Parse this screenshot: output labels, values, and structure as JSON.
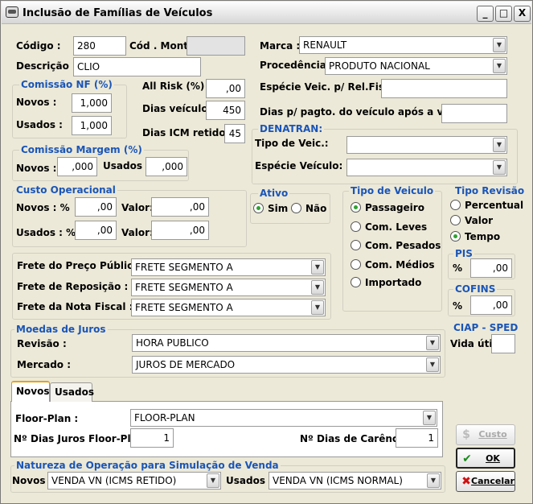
{
  "window": {
    "title": "Inclusão de Famílias de Veículos",
    "min": "_",
    "max": "□",
    "close": "X"
  },
  "codigo": {
    "label": "Código :",
    "value": "280"
  },
  "cod_mont": {
    "label": "Cód . Mont.:",
    "value": ""
  },
  "descricao": {
    "label": "Descrição :",
    "value": "CLIO"
  },
  "comissao_nf": {
    "title": "Comissão NF (%)",
    "novos_label": "Novos :",
    "novos": "1,000",
    "usados_label": "Usados :",
    "usados": "1,000"
  },
  "all_risk": {
    "label": "All Risk (%) :",
    "value": ",00"
  },
  "dias_veiculo": {
    "label": "Dias veículo:",
    "value": "450"
  },
  "dias_icms": {
    "label": "Dias ICM retido :",
    "value": "45"
  },
  "comissao_margem": {
    "title": "Comissão Margem (%)",
    "novos_label": "Novos :",
    "novos": ",000",
    "usados_label": "Usados :",
    "usados": ",000"
  },
  "custo_operacional": {
    "title": "Custo Operacional",
    "novos_label": "Novos : %",
    "novos_pct": ",00",
    "valor_label": "Valor:",
    "novos_valor": ",00",
    "usados_label": "Usados : %",
    "usados_pct": ",00",
    "usados_valor": ",00"
  },
  "marca": {
    "label": "Marca :",
    "value": "RENAULT"
  },
  "procedencia": {
    "label": "Procedência :",
    "value": "PRODUTO NACIONAL"
  },
  "especie_fiscal": {
    "label": "Espécie Veic. p/ Rel.Fiscal:",
    "value": ""
  },
  "dias_pagto": {
    "label": "Dias p/ pagto. do veículo após a venda:",
    "value": ""
  },
  "denatran": {
    "title": "DENATRAN:",
    "tipo_label": "Tipo de Veic.:",
    "tipo": "",
    "especie_label": "Espécie Veículo:",
    "especie": ""
  },
  "ativo": {
    "title": "Ativo",
    "sim": "Sim",
    "nao": "Não"
  },
  "tipo_veiculo": {
    "title": "Tipo de Veiculo",
    "options": [
      "Passageiro",
      "Com. Leves",
      "Com. Pesados",
      "Com. Médios",
      "Importado"
    ]
  },
  "tipo_revisao": {
    "title": "Tipo Revisão",
    "options": [
      "Percentual",
      "Valor",
      "Tempo"
    ]
  },
  "pis": {
    "title": "PIS",
    "pct": "%",
    "value": ",00"
  },
  "cofins": {
    "title": "COFINS",
    "pct": "%",
    "value": ",00"
  },
  "fretes": [
    {
      "label": "Frete do Preço Público :",
      "value": "FRETE SEGMENTO A"
    },
    {
      "label": "Frete de Reposição :",
      "value": "FRETE SEGMENTO A"
    },
    {
      "label": "Frete da Nota Fiscal :",
      "value": "FRETE SEGMENTO A"
    }
  ],
  "moedas": {
    "title": "Moedas de Juros",
    "revisao_label": "Revisão :",
    "revisao": "HORA PUBLICO",
    "mercado_label": "Mercado :",
    "mercado": "JUROS DE MERCADO"
  },
  "ciap": {
    "title": "CIAP - SPED",
    "label": "Vida útil:",
    "value": ""
  },
  "tabs": {
    "novos": "Novos",
    "usados": "Usados"
  },
  "floor": {
    "label": "Floor-Plan :",
    "value": "FLOOR-PLAN",
    "juros_label": "Nº Dias Juros Floor-Plan :",
    "juros": "1",
    "carencia_label": "Nº Dias de Carência:",
    "carencia": "1"
  },
  "natureza": {
    "title": "Natureza de Operação para Simulação de Venda",
    "novos_label": "Novos :",
    "novos": "VENDA VN (ICMS RETIDO)",
    "usados_label": "Usados :",
    "usados": "VENDA VN (ICMS NORMAL)"
  },
  "buttons": {
    "custo": "Custo",
    "ok": "OK",
    "cancelar": "Cancelar"
  }
}
